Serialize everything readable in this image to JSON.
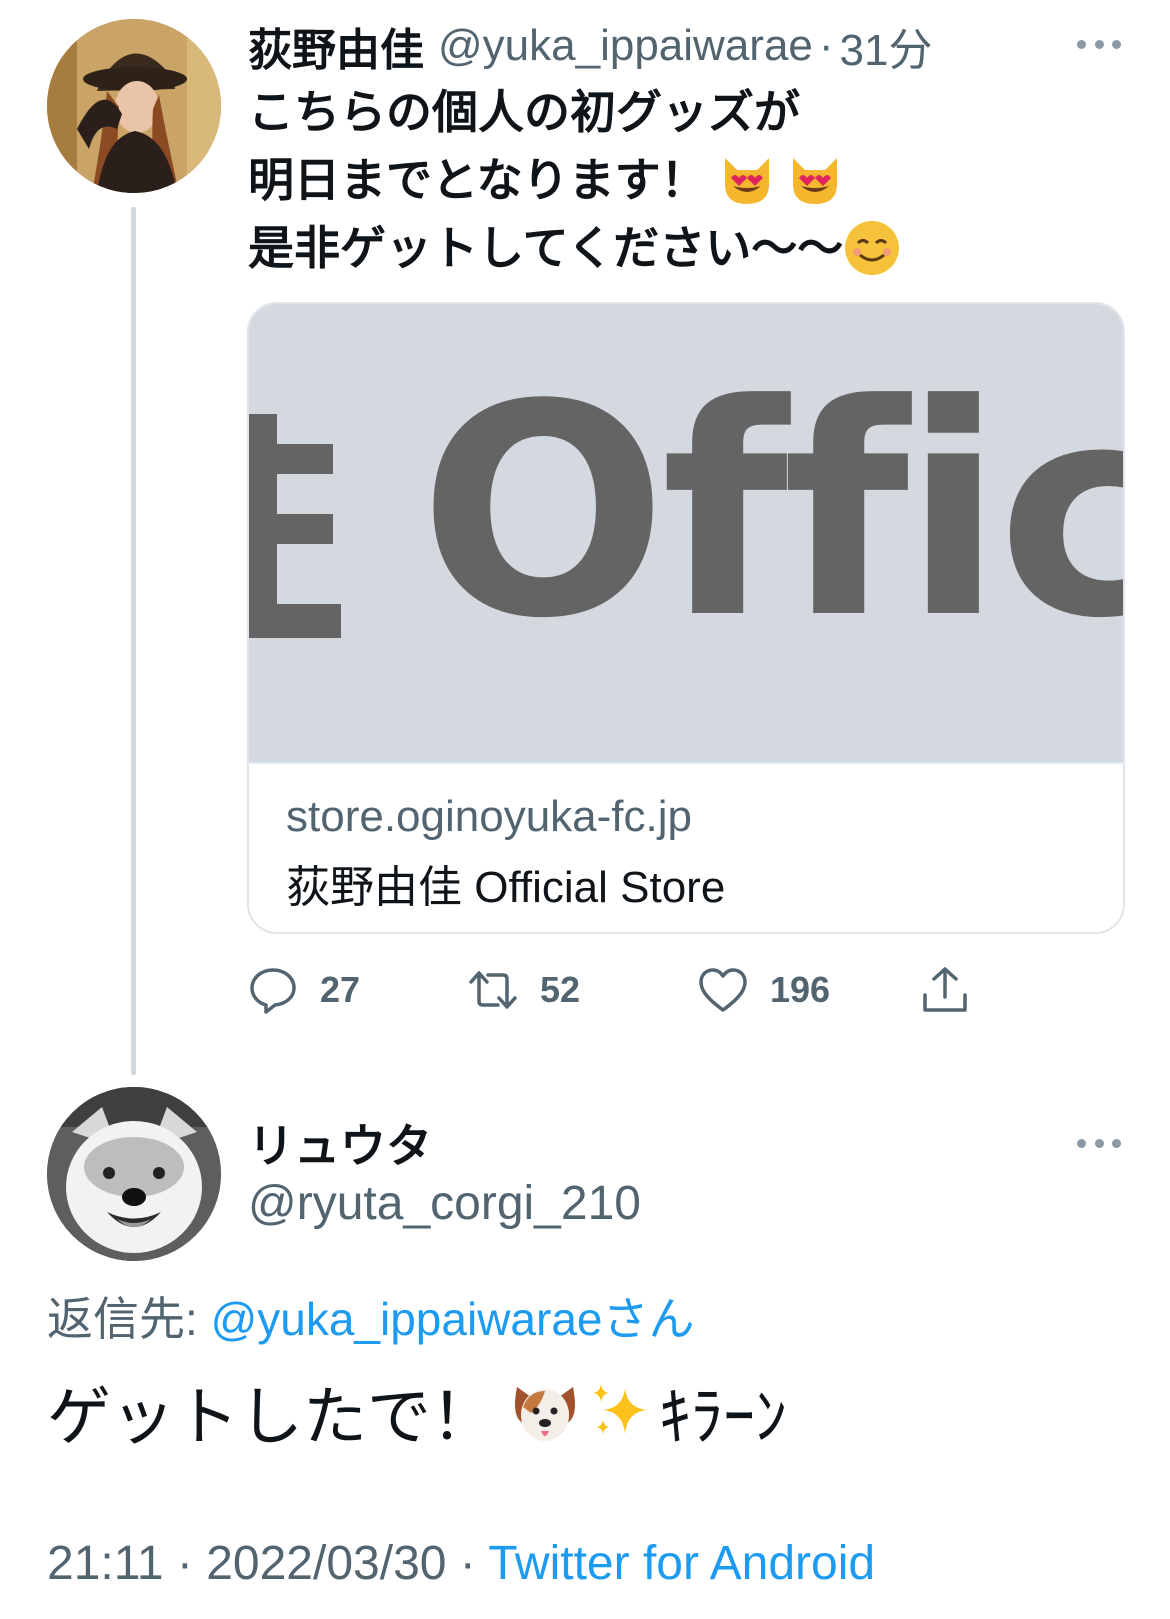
{
  "tweet1": {
    "display_name": "荻野由佳",
    "handle": "@yuka_ippaiwarae",
    "separator": "·",
    "time": "31分",
    "text_line1": "こちらの個人の初グッズが",
    "text_line2": "明日までとなります！",
    "text_line3": "是非ゲットしてください〜〜",
    "emojis": [
      "heart-eyes-cat",
      "heart-eyes-cat",
      "smiling-face"
    ],
    "card": {
      "image_text": "Officia",
      "domain": "store.oginoyuka-fc.jp",
      "title": "荻野由佳 Official Store"
    },
    "actions": {
      "replies": "27",
      "retweets": "52",
      "likes": "196"
    }
  },
  "tweet2": {
    "display_name": "リュウタ",
    "handle": "@ryuta_corgi_210",
    "reply_prefix": "返信先: ",
    "reply_mention": "@yuka_ippaiwaraeさん",
    "text_main": "ゲットしたで！",
    "text_tail": "ｷﾗｰﾝ",
    "emojis": [
      "dog-face",
      "sparkles"
    ],
    "time": "21:11",
    "date": "2022/03/30",
    "meta_sep": " · ",
    "source": "Twitter for Android"
  },
  "colors": {
    "text_primary": "#0f1419",
    "text_secondary": "#536471",
    "link": "#1d9bf0",
    "thread_line": "#cfd9de",
    "card_image_bg": "#d3d9de"
  }
}
